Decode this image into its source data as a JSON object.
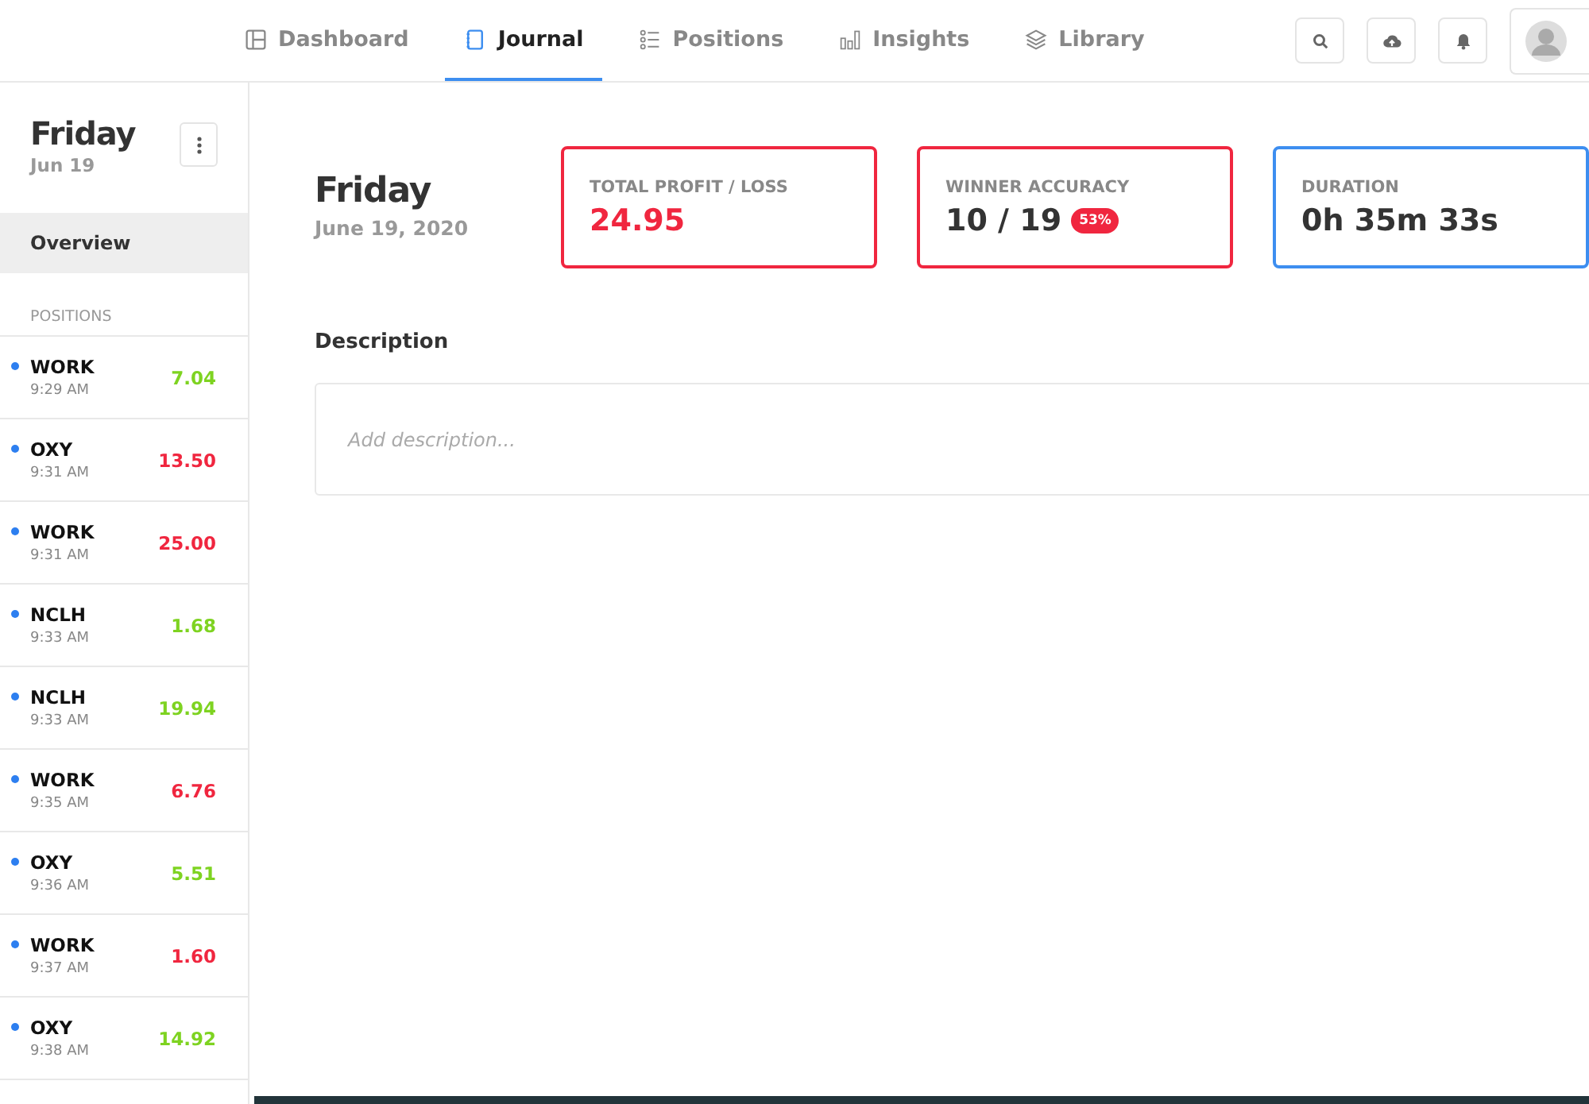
{
  "nav": {
    "tabs": [
      {
        "label": "Dashboard",
        "selected": false
      },
      {
        "label": "Journal",
        "selected": true
      },
      {
        "label": "Positions",
        "selected": false
      },
      {
        "label": "Insights",
        "selected": false
      },
      {
        "label": "Library",
        "selected": false
      }
    ]
  },
  "sidebar": {
    "title": "Friday",
    "subtitle": "Jun 19",
    "items": [
      {
        "label": "Overview",
        "selected": true
      }
    ],
    "section_label": "POSITIONS",
    "positions": [
      {
        "symbol": "WORK",
        "time": "9:29 AM",
        "pnl": "7.04",
        "color": "#7ed321"
      },
      {
        "symbol": "OXY",
        "time": "9:31 AM",
        "pnl": "13.50",
        "color": "#f0263f"
      },
      {
        "symbol": "WORK",
        "time": "9:31 AM",
        "pnl": "25.00",
        "color": "#f0263f"
      },
      {
        "symbol": "NCLH",
        "time": "9:33 AM",
        "pnl": "1.68",
        "color": "#7ed321"
      },
      {
        "symbol": "NCLH",
        "time": "9:33 AM",
        "pnl": "19.94",
        "color": "#7ed321"
      },
      {
        "symbol": "WORK",
        "time": "9:35 AM",
        "pnl": "6.76",
        "color": "#f0263f"
      },
      {
        "symbol": "OXY",
        "time": "9:36 AM",
        "pnl": "5.51",
        "color": "#7ed321"
      },
      {
        "symbol": "WORK",
        "time": "9:37 AM",
        "pnl": "1.60",
        "color": "#f0263f"
      },
      {
        "symbol": "OXY",
        "time": "9:38 AM",
        "pnl": "14.92",
        "color": "#7ed321"
      }
    ]
  },
  "main": {
    "title": "Friday",
    "date": "June 19, 2020",
    "cards": [
      {
        "label": "TOTAL PROFIT / LOSS",
        "value": "24.95",
        "color": "#f0263f",
        "kind": "money"
      },
      {
        "label": "WINNER ACCURACY",
        "value": "10 / 19",
        "badge": "53%",
        "color": "#f0263f",
        "kind": "ratio"
      },
      {
        "label": "DURATION",
        "value": "0h 35m 33s",
        "color": "#3d8ef0",
        "kind": "duration"
      }
    ],
    "description_heading": "Description",
    "description": {
      "placeholder": "Add description..."
    }
  }
}
